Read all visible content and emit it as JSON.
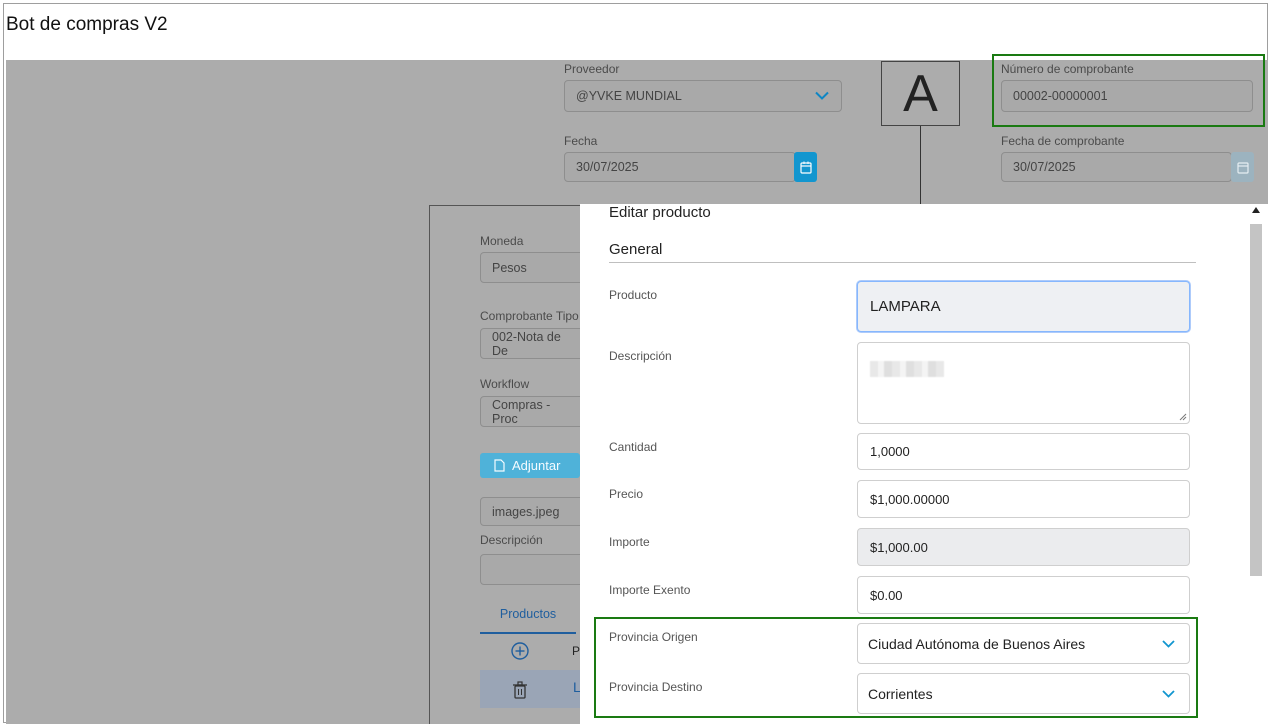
{
  "app": {
    "title": "Bot de compras V2"
  },
  "header": {
    "proveedor_label": "Proveedor",
    "proveedor_value": "@YVKE MUNDIAL",
    "comprobante_type": "A",
    "numero_label": "Número de comprobante",
    "numero_value": "00002-00000001",
    "fecha_label": "Fecha",
    "fecha_value": "30/07/2025",
    "fecha_comprobante_label": "Fecha de comprobante",
    "fecha_comprobante_value": "30/07/2025"
  },
  "left_form": {
    "moneda_label": "Moneda",
    "moneda_value": "Pesos",
    "comprobante_tipo_label": "Comprobante Tipo",
    "comprobante_tipo_value": "002-Nota de De",
    "workflow_label": "Workflow",
    "workflow_value": "Compras - Proc",
    "adjuntar_label": "Adjuntar",
    "file_name": "images.jpeg",
    "descripcion_label": "Descripción",
    "productos_tab": "Productos",
    "col_fragment": "P",
    "row_fragment": "L"
  },
  "modal": {
    "title": "Editar producto",
    "section": "General",
    "producto_label": "Producto",
    "producto_value": "LAMPARA",
    "descripcion_label": "Descripción",
    "cantidad_label": "Cantidad",
    "cantidad_value": "1,0000",
    "precio_label": "Precio",
    "precio_value": "$1,000.00000",
    "importe_label": "Importe",
    "importe_value": "$1,000.00",
    "importe_exento_label": "Importe Exento",
    "importe_exento_value": "$0.00",
    "provincia_origen_label": "Provincia Origen",
    "provincia_origen_value": "Ciudad Autónoma de Buenos Aires",
    "provincia_destino_label": "Provincia Destino",
    "provincia_destino_value": "Corrientes"
  },
  "colors": {
    "accent": "#1296cf",
    "highlight": "#1a7a12",
    "overlay": "#acacac"
  }
}
